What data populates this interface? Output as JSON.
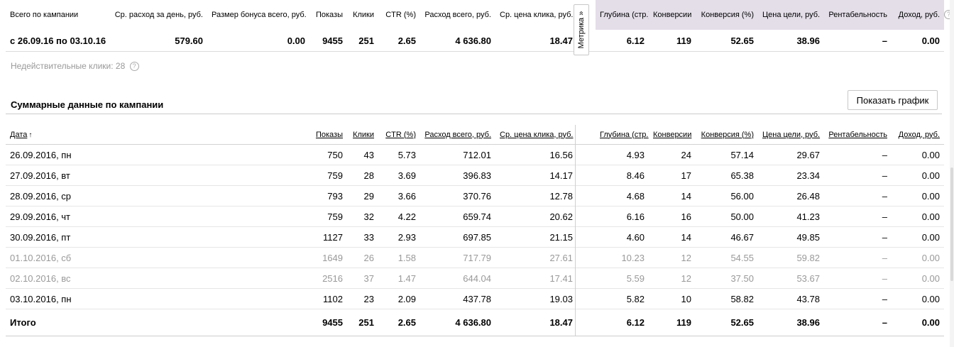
{
  "summary": {
    "headers": {
      "campaign": "Всего по кампании",
      "avg_daily": "Ср. расход за день, руб.",
      "bonus": "Размер бонуса всего, руб.",
      "impressions": "Показы",
      "clicks": "Клики",
      "ctr": "CTR (%)",
      "spend": "Расход всего, руб.",
      "avg_cpc": "Ср. цена клика, руб.",
      "depth": "Глубина (стр.)",
      "conversions": "Конверсии",
      "conv_rate": "Конверсия (%)",
      "goal_cost": "Цена цели, руб.",
      "profitability": "Рентабельность",
      "revenue": "Доход, руб."
    },
    "row": {
      "period": "с 26.09.16 по 03.10.16",
      "avg_daily": "579.60",
      "bonus": "0.00",
      "impressions": "9455",
      "clicks": "251",
      "ctr": "2.65",
      "spend": "4 636.80",
      "avg_cpc": "18.47",
      "depth": "6.12",
      "conversions": "119",
      "conv_rate": "52.65",
      "goal_cost": "38.96",
      "profitability": "–",
      "revenue": "0.00"
    },
    "metrika_tab": "Метрика »",
    "help_icon": "?"
  },
  "invalid_clicks": {
    "label": "Недействительные клики: 28",
    "help_icon": "?"
  },
  "section_title": "Суммарные данные по кампании",
  "show_chart_button": "Показать график",
  "daily": {
    "headers": {
      "date": "Дата",
      "sort_arrow": "↑",
      "impressions": "Показы",
      "clicks": "Клики",
      "ctr": "CTR (%)",
      "spend": "Расход всего, руб.",
      "avg_cpc": "Ср. цена клика, руб.",
      "depth": "Глубина (стр.)",
      "conversions": "Конверсии",
      "conv_rate": "Конверсия (%)",
      "goal_cost": "Цена цели, руб.",
      "profitability": "Рентабельность",
      "revenue": "Доход, руб."
    },
    "rows": [
      {
        "date": "26.09.2016, пн",
        "impressions": "750",
        "clicks": "43",
        "ctr": "5.73",
        "spend": "712.01",
        "avg_cpc": "16.56",
        "depth": "4.93",
        "conversions": "24",
        "conv_rate": "57.14",
        "goal_cost": "29.67",
        "profitability": "–",
        "revenue": "0.00"
      },
      {
        "date": "27.09.2016, вт",
        "impressions": "759",
        "clicks": "28",
        "ctr": "3.69",
        "spend": "396.83",
        "avg_cpc": "14.17",
        "depth": "8.46",
        "conversions": "17",
        "conv_rate": "65.38",
        "goal_cost": "23.34",
        "profitability": "–",
        "revenue": "0.00"
      },
      {
        "date": "28.09.2016, ср",
        "impressions": "793",
        "clicks": "29",
        "ctr": "3.66",
        "spend": "370.76",
        "avg_cpc": "12.78",
        "depth": "4.68",
        "conversions": "14",
        "conv_rate": "56.00",
        "goal_cost": "26.48",
        "profitability": "–",
        "revenue": "0.00"
      },
      {
        "date": "29.09.2016, чт",
        "impressions": "759",
        "clicks": "32",
        "ctr": "4.22",
        "spend": "659.74",
        "avg_cpc": "20.62",
        "depth": "6.16",
        "conversions": "16",
        "conv_rate": "50.00",
        "goal_cost": "41.23",
        "profitability": "–",
        "revenue": "0.00"
      },
      {
        "date": "30.09.2016, пт",
        "impressions": "1127",
        "clicks": "33",
        "ctr": "2.93",
        "spend": "697.85",
        "avg_cpc": "21.15",
        "depth": "4.60",
        "conversions": "14",
        "conv_rate": "46.67",
        "goal_cost": "49.85",
        "profitability": "–",
        "revenue": "0.00"
      },
      {
        "date": "01.10.2016, сб",
        "impressions": "1649",
        "clicks": "26",
        "ctr": "1.58",
        "spend": "717.79",
        "avg_cpc": "27.61",
        "depth": "10.23",
        "conversions": "12",
        "conv_rate": "54.55",
        "goal_cost": "59.82",
        "profitability": "–",
        "revenue": "0.00"
      },
      {
        "date": "02.10.2016, вс",
        "impressions": "2516",
        "clicks": "37",
        "ctr": "1.47",
        "spend": "644.04",
        "avg_cpc": "17.41",
        "depth": "5.59",
        "conversions": "12",
        "conv_rate": "37.50",
        "goal_cost": "53.67",
        "profitability": "–",
        "revenue": "0.00"
      },
      {
        "date": "03.10.2016, пн",
        "impressions": "1102",
        "clicks": "23",
        "ctr": "2.09",
        "spend": "437.78",
        "avg_cpc": "19.03",
        "depth": "5.82",
        "conversions": "10",
        "conv_rate": "58.82",
        "goal_cost": "43.78",
        "profitability": "–",
        "revenue": "0.00"
      }
    ],
    "weekend_rows": [
      5,
      6
    ],
    "total": {
      "label": "Итого",
      "impressions": "9455",
      "clicks": "251",
      "ctr": "2.65",
      "spend": "4 636.80",
      "avg_cpc": "18.47",
      "depth": "6.12",
      "conversions": "119",
      "conv_rate": "52.65",
      "goal_cost": "38.96",
      "profitability": "–",
      "revenue": "0.00"
    }
  },
  "colors": {
    "metrika_header_bg": "#e4dee9",
    "weekend_text": "#999999"
  }
}
